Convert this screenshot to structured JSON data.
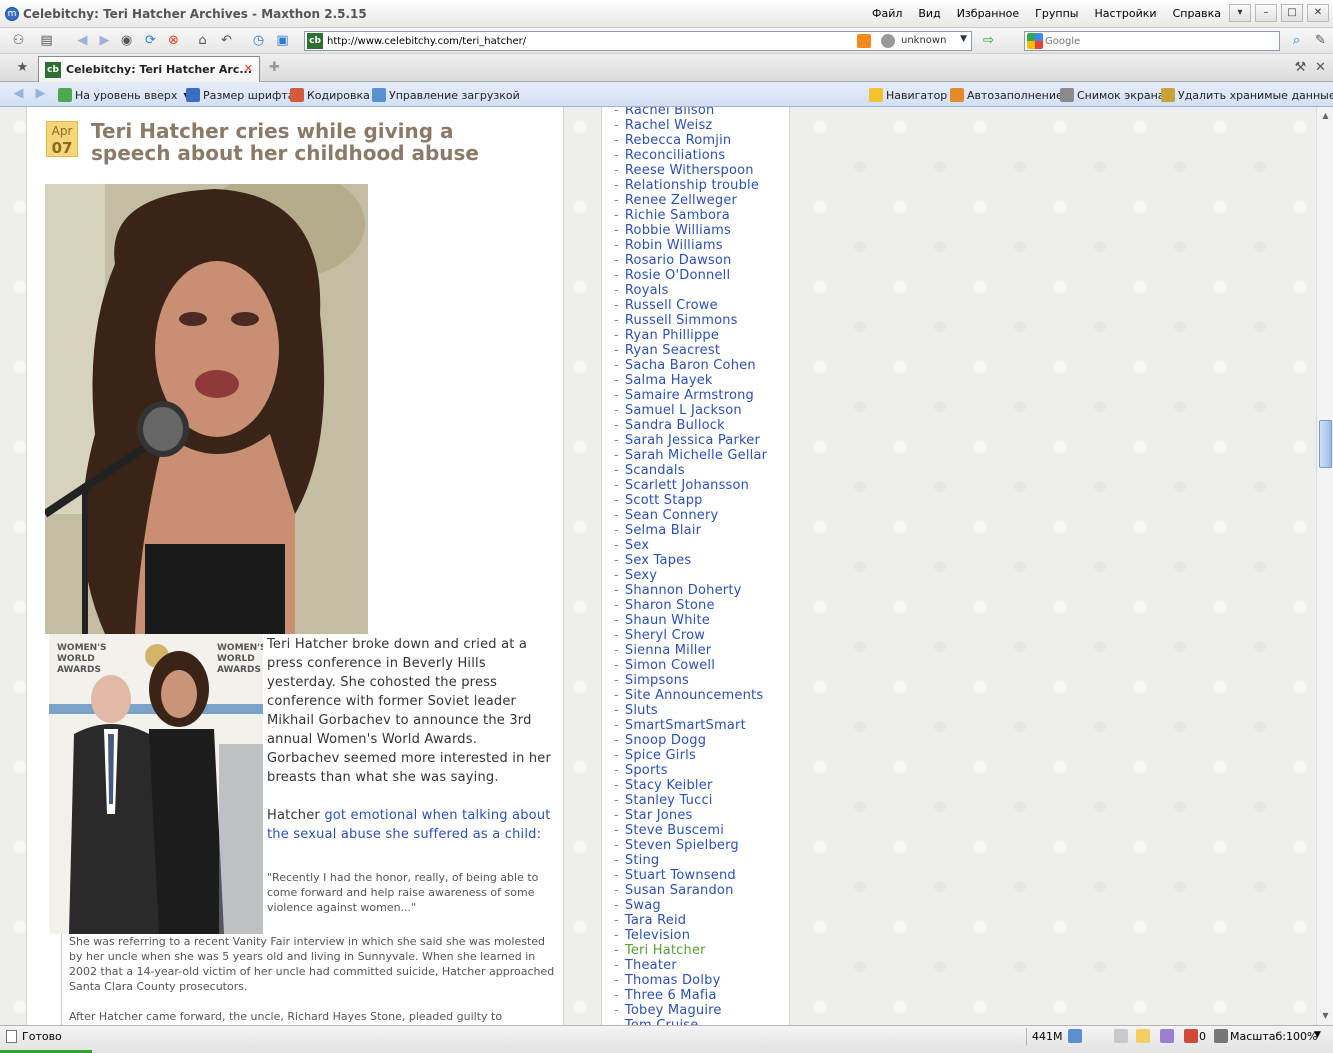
{
  "window": {
    "title": "Celebitchy: Teri Hatcher Archives - Maxthon 2.5.15",
    "menu": [
      "Файл",
      "Вид",
      "Избранное",
      "Группы",
      "Настройки",
      "Справка"
    ]
  },
  "address_bar": {
    "url": "http://www.celebitchy.com/teri_hatcher/",
    "security_status": "unknown",
    "search_placeholder": "Google"
  },
  "tab": {
    "label": "Celebitchy: Teri Hatcher Arc..."
  },
  "linkbar": {
    "left_items": [
      "На уровень вверх",
      "Размер шрифта",
      "Кодировка",
      "Управление загрузкой"
    ],
    "right_items": [
      "Навигатор",
      "Автозаполнение",
      "Снимок экрана",
      "Удалить хранимые данные..."
    ]
  },
  "post": {
    "date_month": "Apr",
    "date_day": "07",
    "title": "Teri Hatcher cries while giving a speech about her childhood abuse",
    "photo2_sign_lines": [
      "WOMEN'S",
      "WORLD",
      "AWARDS"
    ],
    "para1": "Teri Hatcher broke down and cried at a press conference in Beverly Hills yesterday. She cohosted the press conference with former Soviet leader Mikhail Gorbachev to announce the 3rd annual Women's World Awards. Gorbachev seemed more interested in her breasts than what she was saying.",
    "para2_prefix": "Hatcher ",
    "para2_link": "got emotional when talking about the sexual abuse she suffered as a child:",
    "quote": "\"Recently I had the honor, really, of being able to come forward and help raise awareness of some violence against women...\"",
    "after_para1": "She was referring to a recent Vanity Fair interview in which she said she was molested by her uncle when she was 5 years old and living in Sunnyvale. When she learned in 2002 that a 14-year-old victim of her uncle had committed suicide, Hatcher approached Santa Clara County prosecutors.",
    "after_para2": "After Hatcher came forward, the uncle, Richard Hayes Stone, pleaded guilty to"
  },
  "sidebar": {
    "categories": [
      "Rachel Bilson",
      "Rachel Weisz",
      "Rebecca Romjin",
      "Reconciliations",
      "Reese Witherspoon",
      "Relationship trouble",
      "Renee Zellweger",
      "Richie Sambora",
      "Robbie Williams",
      "Robin Williams",
      "Rosario Dawson",
      "Rosie O'Donnell",
      "Royals",
      "Russell Crowe",
      "Russell Simmons",
      "Ryan Phillippe",
      "Ryan Seacrest",
      "Sacha Baron Cohen",
      "Salma Hayek",
      "Samaire Armstrong",
      "Samuel L Jackson",
      "Sandra Bullock",
      "Sarah Jessica Parker",
      "Sarah Michelle Gellar",
      "Scandals",
      "Scarlett Johansson",
      "Scott Stapp",
      "Sean Connery",
      "Selma Blair",
      "Sex",
      "Sex Tapes",
      "Sexy",
      "Shannon Doherty",
      "Sharon Stone",
      "Shaun White",
      "Sheryl Crow",
      "Sienna Miller",
      "Simon Cowell",
      "Simpsons",
      "Site Announcements",
      "Sluts",
      "SmartSmartSmart",
      "Snoop Dogg",
      "Spice Girls",
      "Sports",
      "Stacy Keibler",
      "Stanley Tucci",
      "Star Jones",
      "Steve Buscemi",
      "Steven Spielberg",
      "Sting",
      "Stuart Townsend",
      "Susan Sarandon",
      "Swag",
      "Tara Reid",
      "Television",
      "Teri Hatcher",
      "Theater",
      "Thomas Dolby",
      "Three 6 Mafia",
      "Tobey Maguire",
      "Tom Cruise"
    ],
    "active_category": "Teri Hatcher"
  },
  "statusbar": {
    "status": "Готово",
    "memory": "441M",
    "count": "0",
    "zoom": "Масштаб:100%"
  },
  "colors": {
    "link": "#2c51b5",
    "active_link": "#5aa133",
    "title": "#8c7a68",
    "date_badge": "#f6d67a"
  }
}
